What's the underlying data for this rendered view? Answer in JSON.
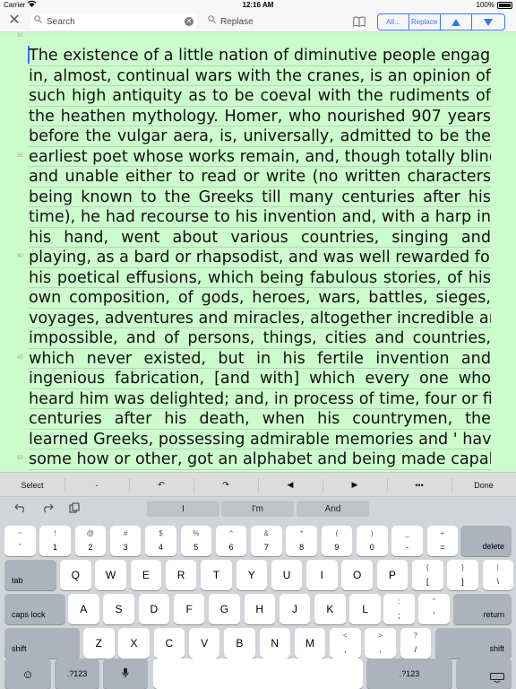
{
  "status": {
    "carrier": "Carrier",
    "time": "12:16 AM",
    "battery": "100%"
  },
  "toolbar": {
    "search_placeholder": "Search",
    "replace_placeholder": "Replase",
    "all_label": "All...",
    "replace_label": "Replace"
  },
  "editor": {
    "line_numbers": [
      {
        "label": "30",
        "line": 0
      },
      {
        "label": "35",
        "line": 5
      },
      {
        "label": "40",
        "line": 10
      },
      {
        "label": "45",
        "line": 15
      },
      {
        "label": "50",
        "line": 20
      }
    ],
    "lines": [
      "The existence of a little nation of diminutive people engaged",
      "in, almost, continual wars with the cranes, is an opinion of",
      "such high antiquity as to be coeval with the rudiments of",
      "the heathen mythology. Homer, who nourished 907 years",
      "before the vulgar aera, is, universally, admitted to be the",
      "earliest poet whose works remain, and, though totally blind",
      "and unable either to read or write (no written characters",
      "being known to the Greeks till many centuries after his",
      "time), he had recourse to his invention and, with a harp in",
      "his hand, went about various countries, singing and",
      "playing, as a bard or rhapsodist, and was well rewarded for",
      "his poetical effusions, which being fabulous stories, of his",
      "own composition, of gods, heroes, wars, battles, sieges,",
      "voyages, adventures and miracles, altogether incredible and",
      "impossible, and of persons, things, cities and countries,",
      "which never existed, but in his fertile invention and",
      "ingenious fabrication, [and with] which every one who",
      "heard him was delighted; and, in process of time, four or five",
      "centuries after his death, when his countrymen, the",
      "learned Greeks, possessing admirable memories and ' having',",
      "some how or other, got an alphabet and being made capable"
    ]
  },
  "shortcuts": [
    "Select",
    "-",
    "↶",
    "↷",
    "◀",
    "▶",
    "•••",
    "Done"
  ],
  "suggestions": [
    "I",
    "I'm",
    "And"
  ],
  "keyboard": {
    "row1": [
      {
        "t": "~",
        "b": "`"
      },
      {
        "t": "!",
        "b": "1"
      },
      {
        "t": "@",
        "b": "2"
      },
      {
        "t": "#",
        "b": "3"
      },
      {
        "t": "$",
        "b": "4"
      },
      {
        "t": "%",
        "b": "5"
      },
      {
        "t": "^",
        "b": "6"
      },
      {
        "t": "&",
        "b": "7"
      },
      {
        "t": "*",
        "b": "8"
      },
      {
        "t": "(",
        "b": "9"
      },
      {
        "t": ")",
        "b": "0"
      },
      {
        "t": "_",
        "b": "-"
      },
      {
        "t": "+",
        "b": "="
      }
    ],
    "delete": "delete",
    "tab": "tab",
    "row2": [
      "Q",
      "W",
      "E",
      "R",
      "T",
      "Y",
      "U",
      "I",
      "O",
      "P"
    ],
    "row2_sym": [
      {
        "t": "{",
        "b": "["
      },
      {
        "t": "}",
        "b": "]"
      },
      {
        "t": "|",
        "b": "\\"
      }
    ],
    "caps": "caps lock",
    "row3": [
      "A",
      "S",
      "D",
      "F",
      "G",
      "H",
      "J",
      "K",
      "L"
    ],
    "row3_sym": [
      {
        "t": ":",
        "b": ";"
      },
      {
        "t": "\"",
        "b": "'"
      }
    ],
    "return": "return",
    "shift": "shift",
    "row4": [
      "Z",
      "X",
      "C",
      "V",
      "B",
      "N",
      "M"
    ],
    "row4_sym": [
      {
        "t": "<",
        "b": ","
      },
      {
        "t": ">",
        "b": "."
      },
      {
        "t": "?",
        "b": "/"
      }
    ],
    "num_label": ".?123"
  }
}
